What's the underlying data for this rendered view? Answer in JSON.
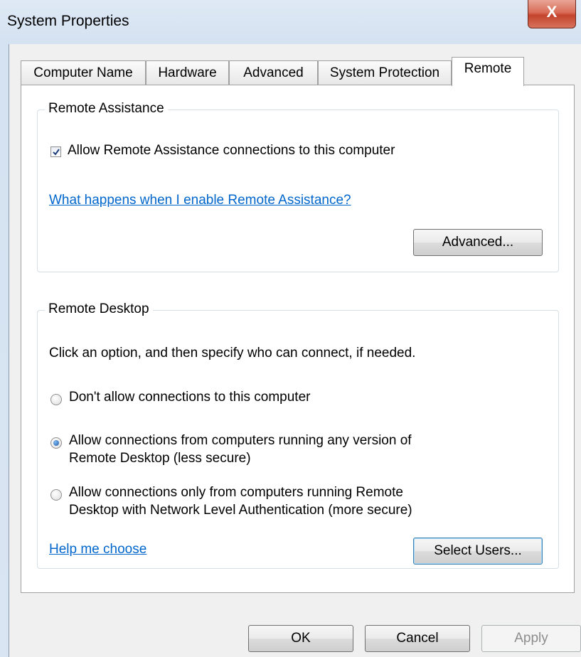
{
  "window": {
    "title": "System Properties",
    "close_label": "X"
  },
  "tabs": [
    {
      "label": "Computer Name"
    },
    {
      "label": "Hardware"
    },
    {
      "label": "Advanced"
    },
    {
      "label": "System Protection"
    },
    {
      "label": "Remote",
      "active": true
    }
  ],
  "remote_assistance": {
    "group_label": "Remote Assistance",
    "allow_checkbox": {
      "label": "Allow Remote Assistance connections to this computer",
      "checked": true
    },
    "help_link": "What happens when I enable Remote Assistance?",
    "advanced_button": "Advanced..."
  },
  "remote_desktop": {
    "group_label": "Remote Desktop",
    "instructions": "Click an option, and then specify who can connect, if needed.",
    "options": [
      {
        "line1": "Don't allow connections to this computer",
        "line2": "",
        "selected": false
      },
      {
        "line1": "Allow connections from computers running any version of",
        "line2": "Remote Desktop (less secure)",
        "selected": true
      },
      {
        "line1": "Allow connections only from computers running Remote",
        "line2": "Desktop with Network Level Authentication (more secure)",
        "selected": false
      }
    ],
    "help_link": "Help me choose",
    "select_users_button": "Select Users..."
  },
  "footer": {
    "ok": "OK",
    "cancel": "Cancel",
    "apply": "Apply"
  },
  "colors": {
    "link": "#0066cc",
    "close_button": "#c4432c",
    "radio_selected": "#1f5fa8"
  }
}
